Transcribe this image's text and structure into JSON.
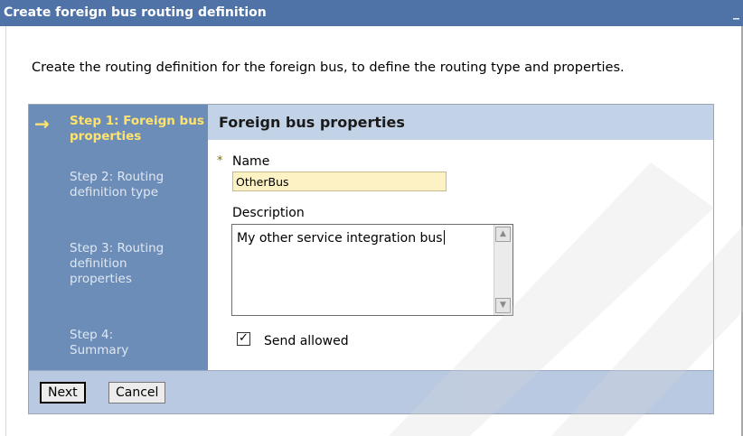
{
  "window": {
    "title": "Create foreign bus routing definition",
    "minimize_glyph": "_"
  },
  "intro_text": "Create the routing definition for the foreign bus, to define the routing type and properties.",
  "steps": [
    {
      "label": "Step 1: Foreign bus properties",
      "current": true
    },
    {
      "label": "Step 2: Routing definition type",
      "current": false
    },
    {
      "label": "Step 3: Routing definition properties",
      "current": false
    },
    {
      "label": "Step 4: Summary",
      "current": false
    }
  ],
  "section_title": "Foreign bus properties",
  "form": {
    "required_marker": "*",
    "name_label": "Name",
    "name_value": "OtherBus",
    "description_label": "Description",
    "description_value": "My other service integration bus",
    "send_allowed_label": "Send allowed",
    "send_allowed_checked": true
  },
  "buttons": {
    "next": "Next",
    "cancel": "Cancel"
  },
  "colors": {
    "title_bar": "#4f73a6",
    "steps_panel": "#6c8db8",
    "current_step": "#ffe36a",
    "section_header": "#c3d3e7",
    "footer": "#b8c9e1",
    "name_field": "#fdf2c4"
  }
}
